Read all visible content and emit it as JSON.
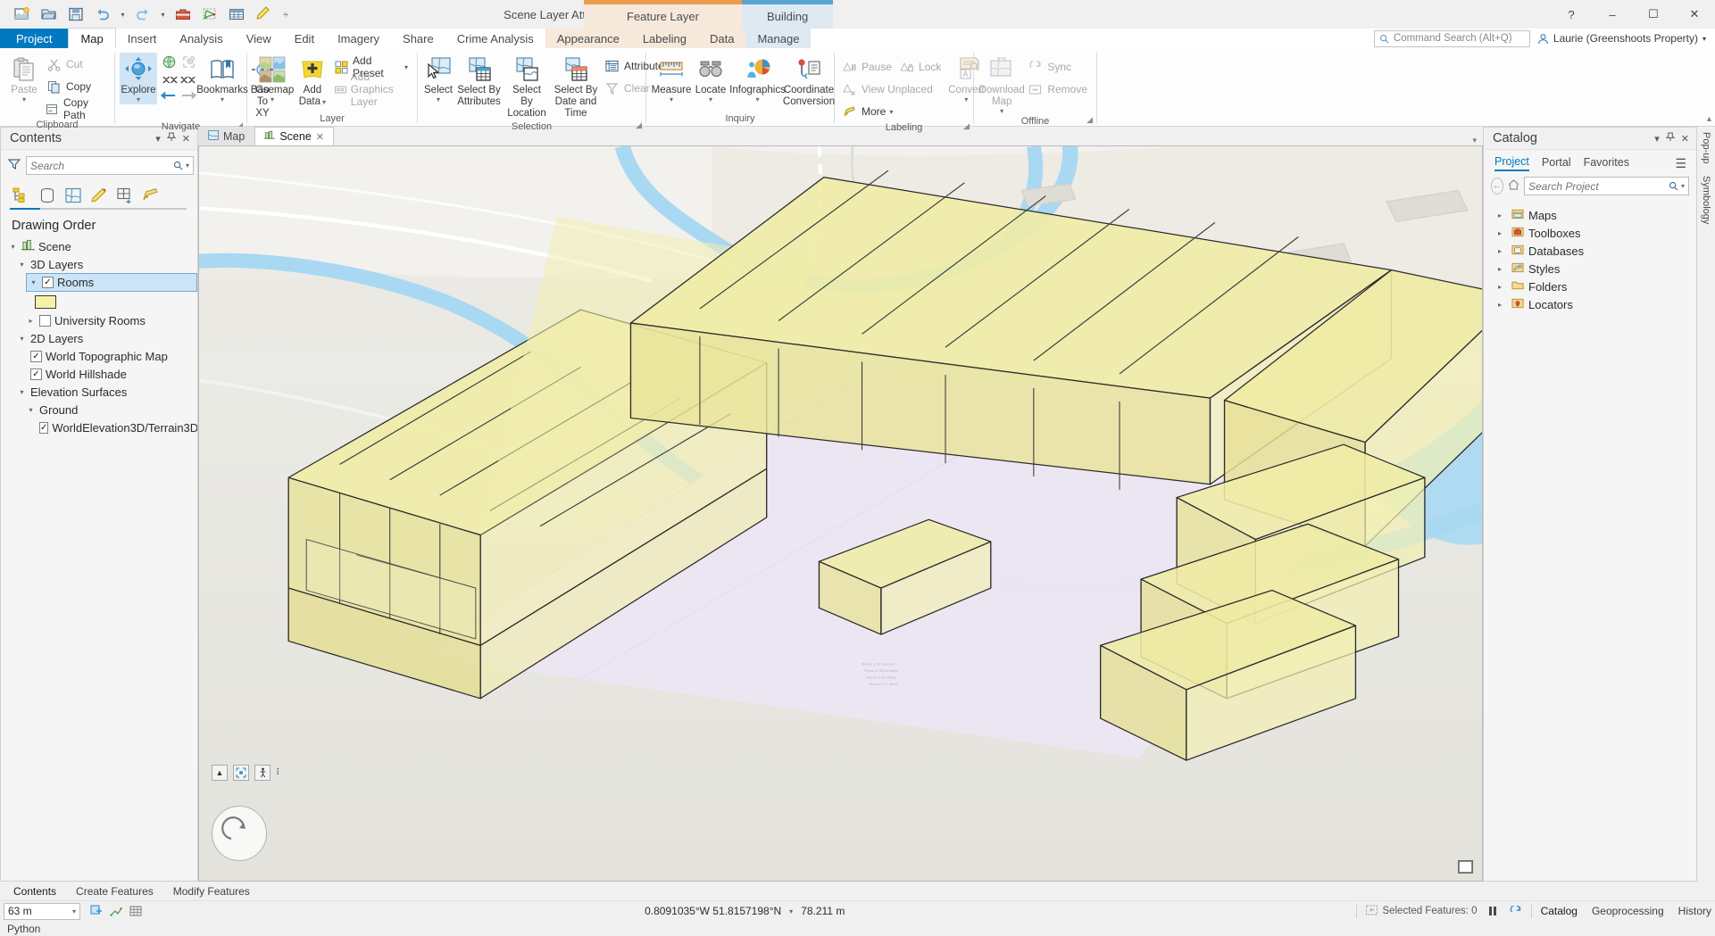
{
  "window": {
    "title": "Scene Layer Attribute Editing - Scene - ArcGIS Pro",
    "minimize": "–",
    "maximize": "☐",
    "close": "✕",
    "help": "?"
  },
  "quick_access": [
    {
      "name": "new-project-icon",
      "glyph": "🖼"
    },
    {
      "name": "open-project-icon",
      "glyph": "📂"
    },
    {
      "name": "save-project-icon",
      "glyph": "💾"
    },
    {
      "name": "undo-icon",
      "glyph": "↶"
    },
    {
      "name": "undo-dropdown-icon",
      "glyph": "▾"
    },
    {
      "name": "redo-icon",
      "glyph": "↷"
    },
    {
      "name": "redo-dropdown-icon",
      "glyph": "▾"
    },
    {
      "name": "toolbox-icon",
      "glyph": "🧰"
    },
    {
      "name": "select-features-icon",
      "glyph": "◱"
    },
    {
      "name": "attribute-table-icon",
      "glyph": "☷"
    },
    {
      "name": "edit-icon",
      "glyph": "✎"
    },
    {
      "name": "customize-qat-icon",
      "glyph": "☰"
    }
  ],
  "contextual_tabs": [
    {
      "label": "Feature Layer",
      "color": "#eb9b4e"
    },
    {
      "label": "Building",
      "color": "#5ba3d0"
    }
  ],
  "ribbon_tabs": {
    "project": "Project",
    "main": [
      "Map",
      "Insert",
      "Analysis",
      "View",
      "Edit",
      "Imagery",
      "Share",
      "Crime Analysis"
    ],
    "active": "Map",
    "feature_layer_tabs": [
      "Appearance",
      "Labeling",
      "Data"
    ],
    "building_tabs": [
      "Manage"
    ]
  },
  "command_search": {
    "placeholder": "Command Search (Alt+Q)",
    "icon": "search-icon"
  },
  "user": {
    "name": "Laurie (Greenshoots Property)",
    "avatar_icon": "user-icon",
    "dropdown": "▾"
  },
  "ribbon_groups": [
    {
      "name": "Clipboard",
      "label": "Clipboard",
      "has_dialog_launcher": false,
      "big_buttons": [
        {
          "label": "Paste",
          "icon": "paste-icon",
          "disabled": true,
          "has_menu": true
        }
      ],
      "small_buttons": [
        {
          "label": "Cut",
          "icon": "cut-icon",
          "disabled": true
        },
        {
          "label": "Copy",
          "icon": "copy-icon",
          "disabled": false
        },
        {
          "label": "Copy Path",
          "icon": "copy-path-icon",
          "disabled": false
        }
      ]
    },
    {
      "name": "Navigate",
      "label": "Navigate",
      "has_dialog_launcher": true,
      "big_buttons": [
        {
          "label": "Explore",
          "icon": "explore-icon",
          "selected": true,
          "has_menu": true
        },
        {
          "label": "Bookmarks",
          "icon": "bookmarks-icon",
          "has_menu": true
        },
        {
          "label": "Go To XY",
          "icon": "go-to-xy-icon",
          "has_menu": false
        }
      ],
      "mini_buttons": [
        {
          "label": "",
          "icon": "full-extent-icon"
        },
        {
          "label": "",
          "icon": "fixed-zoom-in-icon"
        },
        {
          "label": "",
          "icon": "zoom-to-selection-icon"
        },
        {
          "label": "",
          "icon": "zoom-to-layer-icon"
        },
        {
          "label": "",
          "icon": "previous-extent-icon"
        },
        {
          "label": "",
          "icon": "next-extent-icon"
        }
      ]
    },
    {
      "name": "Layer",
      "label": "Layer",
      "has_dialog_launcher": false,
      "big_buttons": [
        {
          "label": "Basemap",
          "icon": "basemap-icon",
          "has_menu": true
        },
        {
          "label": "Add Data",
          "icon": "add-data-icon",
          "has_menu": true
        }
      ],
      "small_buttons": [
        {
          "label": "Add Preset",
          "icon": "add-preset-icon",
          "disabled": false,
          "has_menu": true
        },
        {
          "label": "Add Graphics Layer",
          "icon": "add-graphics-layer-icon",
          "disabled": true
        }
      ]
    },
    {
      "name": "Selection",
      "label": "Selection",
      "has_dialog_launcher": true,
      "big_buttons": [
        {
          "label": "Select",
          "icon": "select-icon",
          "has_menu": true
        },
        {
          "label": "Select By Attributes",
          "icon": "select-by-attributes-icon"
        },
        {
          "label": "Select By Location",
          "icon": "select-by-location-icon"
        },
        {
          "label": "Select By Date and Time",
          "icon": "select-by-date-and-time-icon"
        }
      ],
      "small_buttons": [
        {
          "label": "Attributes",
          "icon": "attributes-icon",
          "disabled": false
        },
        {
          "label": "Clear",
          "icon": "clear-selection-icon",
          "disabled": true
        }
      ]
    },
    {
      "name": "Inquiry",
      "label": "Inquiry",
      "has_dialog_launcher": false,
      "big_buttons": [
        {
          "label": "Measure",
          "icon": "measure-icon",
          "has_menu": true
        },
        {
          "label": "Locate",
          "icon": "locate-icon",
          "has_menu": true
        },
        {
          "label": "Infographics",
          "icon": "infographics-icon",
          "has_menu": true
        },
        {
          "label": "Coordinate Conversion",
          "icon": "coordinate-conversion-icon"
        }
      ]
    },
    {
      "name": "Labeling",
      "label": "Labeling",
      "has_dialog_launcher": true,
      "small_buttons": [
        {
          "label": "Pause",
          "icon": "pause-labeling-icon",
          "disabled": true
        },
        {
          "label": "View Unplaced",
          "icon": "view-unplaced-icon",
          "disabled": true
        },
        {
          "label": "More",
          "icon": "more-labeling-icon",
          "disabled": false,
          "has_menu": true
        }
      ],
      "inline_small": [
        {
          "label": "Lock",
          "icon": "lock-labels-icon",
          "disabled": true
        }
      ],
      "big_buttons": [
        {
          "label": "Convert",
          "icon": "convert-labels-icon",
          "disabled": true,
          "has_menu": true
        }
      ]
    },
    {
      "name": "Offline",
      "label": "Offline",
      "has_dialog_launcher": true,
      "big_buttons": [
        {
          "label": "Download Map",
          "icon": "download-map-icon",
          "disabled": true,
          "has_menu": true
        }
      ],
      "small_buttons": [
        {
          "label": "Sync",
          "icon": "sync-icon",
          "disabled": true
        },
        {
          "label": "Remove",
          "icon": "remove-offline-icon",
          "disabled": true
        }
      ]
    }
  ],
  "contents_pane": {
    "title": "Contents",
    "header_buttons": [
      "▾",
      "📌",
      "✕"
    ],
    "filter_icon": "filter-icon",
    "search": {
      "placeholder": "Search",
      "value": "",
      "icon": "search-icon",
      "dropdown": "▾"
    },
    "view_tabs": [
      {
        "name": "list-by-drawing-order-icon",
        "active": true
      },
      {
        "name": "list-by-data-source-icon",
        "active": false
      },
      {
        "name": "list-by-selection-icon",
        "active": false
      },
      {
        "name": "list-by-editing-icon",
        "active": false
      },
      {
        "name": "list-by-snapping-icon",
        "active": false
      },
      {
        "name": "list-by-labeling-icon",
        "active": false
      }
    ],
    "drawing_order_label": "Drawing Order",
    "tree": [
      {
        "label": "Scene",
        "level": 0,
        "expanded": true,
        "icon": "scene-icon",
        "checkbox": null
      },
      {
        "label": "3D Layers",
        "level": 1,
        "expanded": true,
        "checkbox": null
      },
      {
        "label": "Rooms",
        "level": 2,
        "expanded": true,
        "checkbox": true,
        "selected": true
      },
      {
        "label": "",
        "level": 3,
        "swatch": "#f5f2a8"
      },
      {
        "label": "University Rooms",
        "level": 2,
        "expanded": false,
        "checkbox": false
      },
      {
        "label": "2D Layers",
        "level": 1,
        "expanded": true,
        "checkbox": null
      },
      {
        "label": "World Topographic Map",
        "level": 2,
        "checkbox": true
      },
      {
        "label": "World Hillshade",
        "level": 2,
        "checkbox": true
      },
      {
        "label": "Elevation Surfaces",
        "level": 1,
        "expanded": true,
        "checkbox": null
      },
      {
        "label": "Ground",
        "level": 2,
        "expanded": true,
        "checkbox": null
      },
      {
        "label": "WorldElevation3D/Terrain3D",
        "level": 3,
        "checkbox": true
      }
    ]
  },
  "view_tabs": [
    {
      "label": "Map",
      "icon": "map-icon",
      "active": false,
      "closable": false
    },
    {
      "label": "Scene",
      "icon": "scene-tab-icon",
      "active": true,
      "closable": true
    }
  ],
  "map": {
    "scene_name": "Scene",
    "overlay_tools": [
      "collapse-icon",
      "full-extent-icon",
      "walk-mode-icon",
      "grip-icon"
    ],
    "navigator_icon": "navigator-compass-icon",
    "building_label": "Rooms"
  },
  "catalog_pane": {
    "title": "Catalog",
    "header_buttons": [
      "▾",
      "📌",
      "✕"
    ],
    "tabs": [
      {
        "label": "Project",
        "active": true
      },
      {
        "label": "Portal",
        "active": false
      },
      {
        "label": "Favorites",
        "active": false
      }
    ],
    "menu_icon": "hamburger-icon",
    "back_icon": "back-arrow-icon",
    "home_icon": "home-icon",
    "search": {
      "placeholder": "Search Project",
      "value": "",
      "icon": "search-icon",
      "dropdown": "▾"
    },
    "tree": [
      {
        "label": "Maps",
        "icon": "maps-folder-icon"
      },
      {
        "label": "Toolboxes",
        "icon": "toolboxes-icon"
      },
      {
        "label": "Databases",
        "icon": "databases-icon"
      },
      {
        "label": "Styles",
        "icon": "styles-icon"
      },
      {
        "label": "Folders",
        "icon": "folders-icon"
      },
      {
        "label": "Locators",
        "icon": "locators-icon"
      }
    ]
  },
  "side_tabs": [
    "Pop-up",
    "Symbology"
  ],
  "bottom_tabs": [
    {
      "label": "Contents",
      "active": true
    },
    {
      "label": "Create Features",
      "active": false
    },
    {
      "label": "Modify Features",
      "active": false
    }
  ],
  "status_bar": {
    "scale": "63 m",
    "scale_dropdown": "▾",
    "tool_icons": [
      "selected-features-icon",
      "measure-status-icon",
      "grid-status-icon"
    ],
    "coordinates": "0.8091035°W 51.8157198°N",
    "coordinates_dropdown": "▾",
    "elevation": "78.211 m",
    "selected_features": "Selected Features: 0",
    "selected_features_icon": "selection-icon",
    "pause_icon": "pause-drawing-icon",
    "refresh_icon": "refresh-icon",
    "right_tabs": [
      {
        "label": "Catalog",
        "active": true
      },
      {
        "label": "Geoprocessing",
        "active": false
      },
      {
        "label": "History",
        "active": false
      }
    ]
  },
  "python_bar": {
    "label": "Python"
  }
}
